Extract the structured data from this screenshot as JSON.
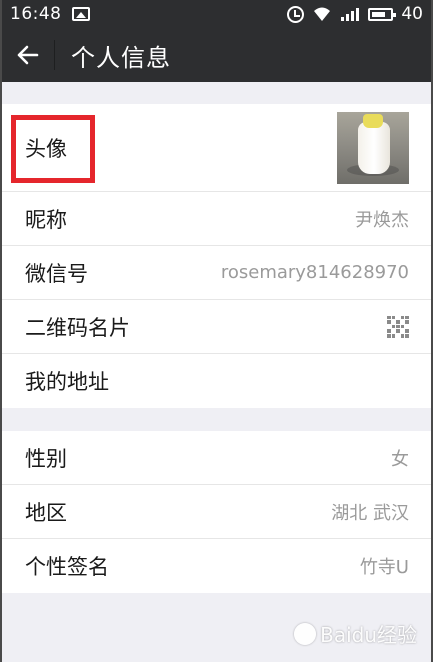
{
  "status_bar": {
    "time": "16:48",
    "battery": "40",
    "icons": [
      "gallery-icon",
      "alarm-icon",
      "wifi-icon",
      "signal-icon",
      "battery-icon"
    ]
  },
  "header": {
    "title": "个人信息",
    "back_icon": "arrow-left-icon"
  },
  "profile": {
    "avatar_label": "头像",
    "nickname_label": "昵称",
    "nickname_value": "尹焕杰",
    "wechat_id_label": "微信号",
    "wechat_id_value": "rosemary814628970",
    "qr_label": "二维码名片",
    "address_label": "我的地址"
  },
  "details": {
    "gender_label": "性别",
    "gender_value": "女",
    "region_label": "地区",
    "region_value": "湖北 武汉",
    "signature_label": "个性签名",
    "signature_value": "竹寺U"
  },
  "annotation": {
    "highlight_color": "#e5262c"
  },
  "watermark": {
    "text": "Baidu经验"
  },
  "colors": {
    "title_bar": "#2d2e30",
    "background": "#efeff4",
    "value_text": "#9a9a9a"
  }
}
